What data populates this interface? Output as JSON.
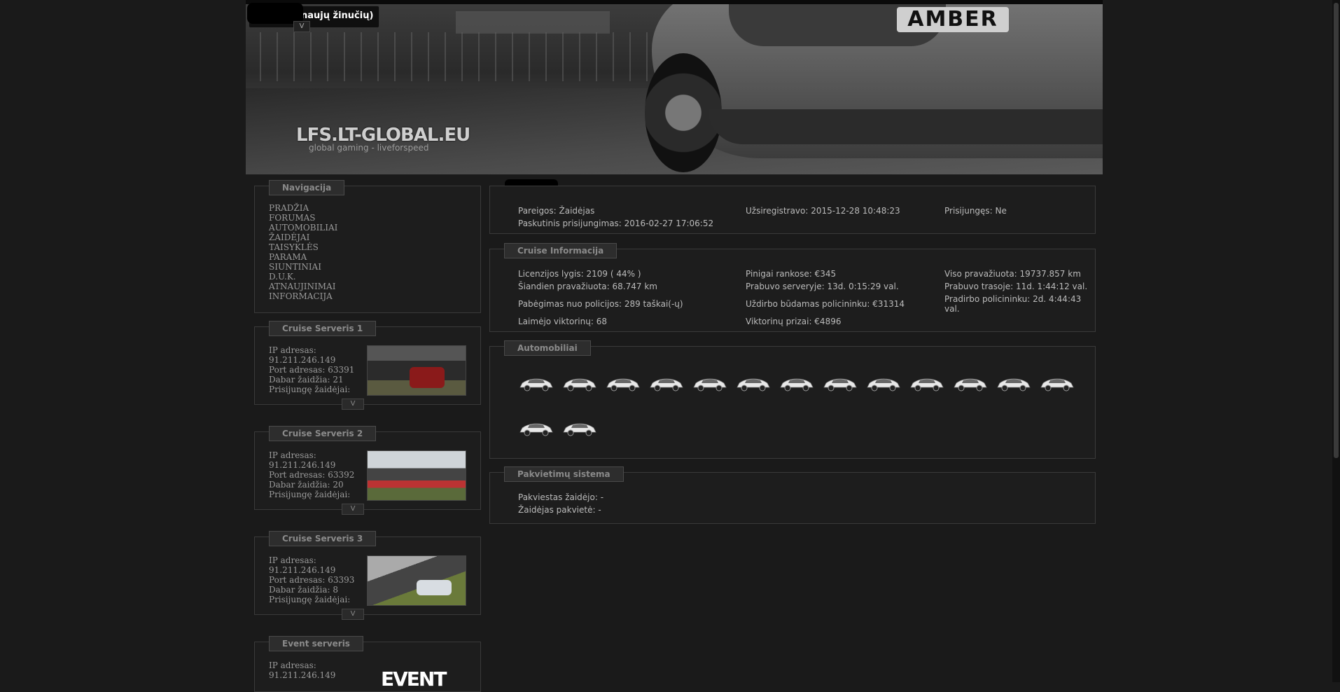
{
  "site": {
    "logo": "LFS.LT-GLOBAL.EU",
    "tagline": "global gaming - liveforspeed",
    "plate": "AMBER"
  },
  "messages": {
    "text": "naujų žinučių)",
    "toggle": "V"
  },
  "navigation": {
    "title": "Navigacija",
    "items": [
      "PRADŽIA",
      "FORUMAS",
      "AUTOMOBILIAI",
      "ŽAIDĖJAI",
      "TAISYKLĖS",
      "PARAMA",
      "SIUNTINIAI",
      "D.U.K.",
      "ATNAUJINIMAI",
      "INFORMACIJA"
    ]
  },
  "servers": [
    {
      "title": "Cruise Serveris 1",
      "ip_label": "IP adresas:",
      "ip": "91.211.246.149",
      "port": "Port adresas: 63391",
      "players": "Dabar žaidžia: 21",
      "joined": "Prisijungę žaidėjai:",
      "toggle": "V"
    },
    {
      "title": "Cruise Serveris 2",
      "ip_label": "IP adresas:",
      "ip": "91.211.246.149",
      "port": "Port adresas: 63392",
      "players": "Dabar žaidžia: 20",
      "joined": "Prisijungę žaidėjai:",
      "toggle": "V"
    },
    {
      "title": "Cruise Serveris 3",
      "ip_label": "IP adresas:",
      "ip": "91.211.246.149",
      "port": "Port adresas: 63393",
      "players": "Dabar žaidžia: 8",
      "joined": "Prisijungę žaidėjai:",
      "toggle": "V"
    },
    {
      "title": "Event serveris",
      "ip_label": "IP adresas:",
      "ip": "91.211.246.149",
      "image_text": "EVENT"
    }
  ],
  "profile": {
    "duties": "Pareigos: Žaidėjas",
    "last_login": "Paskutinis prisijungimas: 2016-02-27 17:06:52",
    "registered": "Užsiregistravo: 2015-12-28 10:48:23",
    "online": "Prisijungęs: Ne"
  },
  "cruise": {
    "title": "Cruise Informacija",
    "license": "Licenzijos lygis: 2109 ( 44% )",
    "today": "Šiandien pravažiuota: 68.747 km",
    "escapes": "Pabėgimas nuo policijos: 289 taškai(-ų)",
    "quiz_wins": "Laimėjo viktorinų: 68",
    "money": "Pinigai rankose: €345",
    "server_time": "Prabuvo serveryje: 13d. 0:15:29 val.",
    "police_earn": "Uždirbo būdamas policininku: €31314",
    "quiz_prizes": "Viktorinų prizai: €4896",
    "total_km": "Viso pravažiuota: 19737.857 km",
    "track_time": "Prabuvo trasoje: 11d. 1:44:12 val.",
    "police_time": "Pradirbo policininku: 2d. 4:44:43 val."
  },
  "cars": {
    "title": "Automobiliai",
    "count": 15
  },
  "invite": {
    "title": "Pakvietimų sistema",
    "invited_by": "Pakviestas žaidėjo: -",
    "invited": "Žaidėjas pakvietė: -"
  },
  "colors": {
    "background": "#1a1a1a",
    "panel": "#1d1d1d",
    "border": "#3a3a3a"
  }
}
